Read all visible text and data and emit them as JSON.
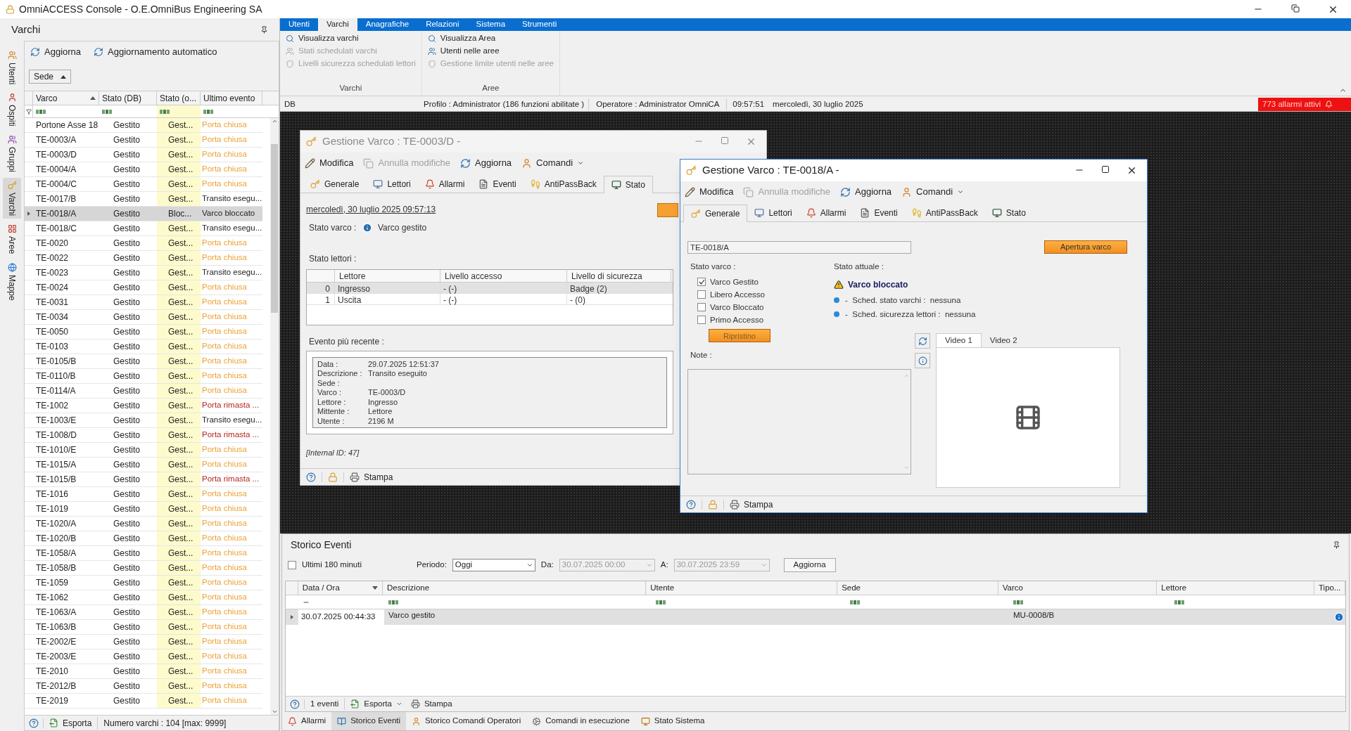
{
  "title_bar": {
    "title": "OmniACCESS Console - O.E.OmniBus Engineering SA"
  },
  "left_panel": {
    "title": "Varchi",
    "toolbar": [
      {
        "label": "Aggiorna"
      },
      {
        "label": "Aggiornamento automatico"
      }
    ],
    "side_tabs": [
      {
        "label": "Utenti",
        "selected": false
      },
      {
        "label": "Ospiti",
        "selected": false
      },
      {
        "label": "Gruppi",
        "selected": false
      },
      {
        "label": "Varchi",
        "selected": true
      },
      {
        "label": "Aree",
        "selected": false
      },
      {
        "label": "Mappe",
        "selected": false
      }
    ],
    "group_chip": "Sede",
    "columns": [
      "Varco",
      "Stato (DB)",
      "Stato (o...",
      "Ultimo evento"
    ],
    "rows": [
      {
        "varco": "Portone Asse 18",
        "stato_db": "Gestito",
        "stato_o": "Gest...",
        "ultimo_evento": "Porta chiusa",
        "color": "#eba134",
        "selected": false
      },
      {
        "varco": "TE-0003/A",
        "stato_db": "Gestito",
        "stato_o": "Gest...",
        "ultimo_evento": "Porta chiusa",
        "color": "#eba134",
        "selected": false
      },
      {
        "varco": "TE-0003/D",
        "stato_db": "Gestito",
        "stato_o": "Gest...",
        "ultimo_evento": "Porta chiusa",
        "color": "#eba134",
        "selected": false
      },
      {
        "varco": "TE-0004/A",
        "stato_db": "Gestito",
        "stato_o": "Gest...",
        "ultimo_evento": "Porta chiusa",
        "color": "#eba134",
        "selected": false
      },
      {
        "varco": "TE-0004/C",
        "stato_db": "Gestito",
        "stato_o": "Gest...",
        "ultimo_evento": "Porta chiusa",
        "color": "#eba134",
        "selected": false
      },
      {
        "varco": "TE-0017/B",
        "stato_db": "Gestito",
        "stato_o": "Gest...",
        "ultimo_evento": "Transito esegu...",
        "color": "#222222",
        "selected": false
      },
      {
        "varco": "TE-0018/A",
        "stato_db": "Gestito",
        "stato_o": "Bloc...",
        "ultimo_evento": "Varco bloccato",
        "color": "#222222",
        "selected": true
      },
      {
        "varco": "TE-0018/C",
        "stato_db": "Gestito",
        "stato_o": "Gest...",
        "ultimo_evento": "Transito esegu...",
        "color": "#222222",
        "selected": false
      },
      {
        "varco": "TE-0020",
        "stato_db": "Gestito",
        "stato_o": "Gest...",
        "ultimo_evento": "Porta chiusa",
        "color": "#eba134",
        "selected": false
      },
      {
        "varco": "TE-0022",
        "stato_db": "Gestito",
        "stato_o": "Gest...",
        "ultimo_evento": "Porta chiusa",
        "color": "#eba134",
        "selected": false
      },
      {
        "varco": "TE-0023",
        "stato_db": "Gestito",
        "stato_o": "Gest...",
        "ultimo_evento": "Transito esegu...",
        "color": "#222222",
        "selected": false
      },
      {
        "varco": "TE-0024",
        "stato_db": "Gestito",
        "stato_o": "Gest...",
        "ultimo_evento": "Porta chiusa",
        "color": "#eba134",
        "selected": false
      },
      {
        "varco": "TE-0031",
        "stato_db": "Gestito",
        "stato_o": "Gest...",
        "ultimo_evento": "Porta chiusa",
        "color": "#eba134",
        "selected": false
      },
      {
        "varco": "TE-0034",
        "stato_db": "Gestito",
        "stato_o": "Gest...",
        "ultimo_evento": "Porta chiusa",
        "color": "#eba134",
        "selected": false
      },
      {
        "varco": "TE-0050",
        "stato_db": "Gestito",
        "stato_o": "Gest...",
        "ultimo_evento": "Porta chiusa",
        "color": "#eba134",
        "selected": false
      },
      {
        "varco": "TE-0103",
        "stato_db": "Gestito",
        "stato_o": "Gest...",
        "ultimo_evento": "Porta chiusa",
        "color": "#eba134",
        "selected": false
      },
      {
        "varco": "TE-0105/B",
        "stato_db": "Gestito",
        "stato_o": "Gest...",
        "ultimo_evento": "Porta chiusa",
        "color": "#eba134",
        "selected": false
      },
      {
        "varco": "TE-0110/B",
        "stato_db": "Gestito",
        "stato_o": "Gest...",
        "ultimo_evento": "Porta chiusa",
        "color": "#eba134",
        "selected": false
      },
      {
        "varco": "TE-0114/A",
        "stato_db": "Gestito",
        "stato_o": "Gest...",
        "ultimo_evento": "Porta chiusa",
        "color": "#eba134",
        "selected": false
      },
      {
        "varco": "TE-1002",
        "stato_db": "Gestito",
        "stato_o": "Gest...",
        "ultimo_evento": "Porta rimasta ...",
        "color": "#b3261e",
        "selected": false
      },
      {
        "varco": "TE-1003/E",
        "stato_db": "Gestito",
        "stato_o": "Gest...",
        "ultimo_evento": "Transito esegu...",
        "color": "#222222",
        "selected": false
      },
      {
        "varco": "TE-1008/D",
        "stato_db": "Gestito",
        "stato_o": "Gest...",
        "ultimo_evento": "Porta rimasta ...",
        "color": "#b3261e",
        "selected": false
      },
      {
        "varco": "TE-1010/E",
        "stato_db": "Gestito",
        "stato_o": "Gest...",
        "ultimo_evento": "Porta chiusa",
        "color": "#eba134",
        "selected": false
      },
      {
        "varco": "TE-1015/A",
        "stato_db": "Gestito",
        "stato_o": "Gest...",
        "ultimo_evento": "Porta chiusa",
        "color": "#eba134",
        "selected": false
      },
      {
        "varco": "TE-1015/B",
        "stato_db": "Gestito",
        "stato_o": "Gest...",
        "ultimo_evento": "Porta rimasta ...",
        "color": "#b3261e",
        "selected": false
      },
      {
        "varco": "TE-1016",
        "stato_db": "Gestito",
        "stato_o": "Gest...",
        "ultimo_evento": "Porta chiusa",
        "color": "#eba134",
        "selected": false
      },
      {
        "varco": "TE-1019",
        "stato_db": "Gestito",
        "stato_o": "Gest...",
        "ultimo_evento": "Porta chiusa",
        "color": "#eba134",
        "selected": false
      },
      {
        "varco": "TE-1020/A",
        "stato_db": "Gestito",
        "stato_o": "Gest...",
        "ultimo_evento": "Porta chiusa",
        "color": "#eba134",
        "selected": false
      },
      {
        "varco": "TE-1020/B",
        "stato_db": "Gestito",
        "stato_o": "Gest...",
        "ultimo_evento": "Porta chiusa",
        "color": "#eba134",
        "selected": false
      },
      {
        "varco": "TE-1058/A",
        "stato_db": "Gestito",
        "stato_o": "Gest...",
        "ultimo_evento": "Porta chiusa",
        "color": "#eba134",
        "selected": false
      },
      {
        "varco": "TE-1058/B",
        "stato_db": "Gestito",
        "stato_o": "Gest...",
        "ultimo_evento": "Porta chiusa",
        "color": "#eba134",
        "selected": false
      },
      {
        "varco": "TE-1059",
        "stato_db": "Gestito",
        "stato_o": "Gest...",
        "ultimo_evento": "Porta chiusa",
        "color": "#eba134",
        "selected": false
      },
      {
        "varco": "TE-1062",
        "stato_db": "Gestito",
        "stato_o": "Gest...",
        "ultimo_evento": "Porta chiusa",
        "color": "#eba134",
        "selected": false
      },
      {
        "varco": "TE-1063/A",
        "stato_db": "Gestito",
        "stato_o": "Gest...",
        "ultimo_evento": "Porta chiusa",
        "color": "#eba134",
        "selected": false
      },
      {
        "varco": "TE-1063/B",
        "stato_db": "Gestito",
        "stato_o": "Gest...",
        "ultimo_evento": "Porta chiusa",
        "color": "#eba134",
        "selected": false
      },
      {
        "varco": "TE-2002/E",
        "stato_db": "Gestito",
        "stato_o": "Gest...",
        "ultimo_evento": "Porta chiusa",
        "color": "#eba134",
        "selected": false
      },
      {
        "varco": "TE-2003/E",
        "stato_db": "Gestito",
        "stato_o": "Gest...",
        "ultimo_evento": "Porta chiusa",
        "color": "#eba134",
        "selected": false
      },
      {
        "varco": "TE-2010",
        "stato_db": "Gestito",
        "stato_o": "Gest...",
        "ultimo_evento": "Porta chiusa",
        "color": "#eba134",
        "selected": false
      },
      {
        "varco": "TE-2012/B",
        "stato_db": "Gestito",
        "stato_o": "Gest...",
        "ultimo_evento": "Porta chiusa",
        "color": "#eba134",
        "selected": false
      },
      {
        "varco": "TE-2019",
        "stato_db": "Gestito",
        "stato_o": "Gest...",
        "ultimo_evento": "Porta chiusa",
        "color": "#eba134",
        "selected": false
      }
    ],
    "export": "Esporta",
    "count": "Numero varchi : 104 [max: 9999]"
  },
  "ribbon": {
    "tabs": [
      {
        "label": "Utenti",
        "selected": false
      },
      {
        "label": "Varchi",
        "selected": true
      },
      {
        "label": "Anagrafiche",
        "selected": false
      },
      {
        "label": "Relazioni",
        "selected": false
      },
      {
        "label": "Sistema",
        "selected": false
      },
      {
        "label": "Strumenti",
        "selected": false
      }
    ],
    "groups": [
      {
        "title": "Varchi",
        "items": [
          {
            "label": "Visualizza varchi",
            "disabled": false
          },
          {
            "label": "Stati schedulati varchi",
            "disabled": true
          },
          {
            "label": "Livelli sicurezza schedulati lettori",
            "disabled": true
          }
        ]
      },
      {
        "title": "Aree",
        "items": [
          {
            "label": "Visualizza Area",
            "disabled": false
          },
          {
            "label": "Utenti nelle aree",
            "disabled": false
          },
          {
            "label": "Gestione limite utenti nelle aree",
            "disabled": true
          }
        ]
      }
    ]
  },
  "status_line": {
    "db": "DB",
    "profile": "Profilo : Administrator (186  funzioni abilitate )",
    "operator": "Operatore : Administrator OmniCA",
    "time": "09:57:51",
    "date": "mercoledì, 30 luglio 2025",
    "alarms": "773 allarmi attivi"
  },
  "status_window": {
    "title": "Gestione Varco : TE-0003/D -",
    "active": false,
    "toolbar": [
      {
        "label": "Modifica",
        "disabled": false,
        "dropdown": false
      },
      {
        "label": "Annulla modifiche",
        "disabled": true,
        "dropdown": false
      },
      {
        "label": "Aggiorna",
        "disabled": false,
        "dropdown": false
      },
      {
        "label": "Comandi",
        "disabled": false,
        "dropdown": true
      }
    ],
    "tabs": [
      {
        "label": "Generale",
        "selected": false
      },
      {
        "label": "Lettori",
        "selected": false
      },
      {
        "label": "Allarmi",
        "selected": false
      },
      {
        "label": "Eventi",
        "selected": false
      },
      {
        "label": "AntiPassBack",
        "selected": false
      },
      {
        "label": "Stato",
        "selected": true
      }
    ],
    "timestamp": "mercoledì, 30 luglio 2025 09:57:13",
    "gate_state_label": "Stato varco :",
    "gate_state": "Varco gestito",
    "readers_label": "Stato lettori :",
    "reader_columns": [
      "Lettore",
      "Livello accesso",
      "Livello di sicurezza"
    ],
    "readers": [
      {
        "index": "0",
        "name": "Ingresso",
        "access": "- (-)",
        "security": "Badge (2)",
        "selected": true
      },
      {
        "index": "1",
        "name": "Uscita",
        "access": "- (-)",
        "security": "- (0)",
        "selected": false
      }
    ],
    "event_label": "Evento più recente :",
    "event_fields": [
      {
        "label": "Data :",
        "value": "29.07.2025 12:51:37"
      },
      {
        "label": "Descrizione :",
        "value": "Transito eseguito"
      },
      {
        "label": "Sede :"
      },
      {
        "label": "Varco :",
        "value": "TE-0003/D"
      },
      {
        "label": "Lettore :",
        "value": "Ingresso"
      },
      {
        "label": "Mittente :",
        "value": "Lettore"
      },
      {
        "label": "Utente :",
        "value": "2196 M"
      }
    ],
    "internal_id": "[Internal ID: 47]",
    "print": "Stampa"
  },
  "general_window": {
    "title": "Gestione Varco : TE-0018/A -",
    "active": true,
    "toolbar": [
      {
        "label": "Modifica",
        "disabled": false,
        "dropdown": false
      },
      {
        "label": "Annulla modifiche",
        "disabled": true,
        "dropdown": false
      },
      {
        "label": "Aggiorna",
        "disabled": false,
        "dropdown": false
      },
      {
        "label": "Comandi",
        "disabled": false,
        "dropdown": true
      }
    ],
    "tabs": [
      {
        "label": "Generale",
        "selected": true
      },
      {
        "label": "Lettori",
        "selected": false
      },
      {
        "label": "Allarmi",
        "selected": false
      },
      {
        "label": "Eventi",
        "selected": false
      },
      {
        "label": "AntiPassBack",
        "selected": false
      },
      {
        "label": "Stato",
        "selected": false
      }
    ],
    "gate_code": "TE-0018/A",
    "open_button": "Apertura varco",
    "gate_state_label": "Stato varco :",
    "checks": [
      {
        "label": "Varco Gestito",
        "checked": true
      },
      {
        "label": "Libero Accesso",
        "checked": false
      },
      {
        "label": "Varco Bloccato",
        "checked": false
      },
      {
        "label": "Primo Accesso",
        "checked": false
      }
    ],
    "reset_button": "Ripristino",
    "note_label": "Note :",
    "current_label": "Stato attuale :",
    "current_state": "Varco bloccato",
    "schedules": [
      "-  Sched. stato varchi :  nessuna",
      "-  Sched. sicurezza lettori :  nessuna"
    ],
    "video_tabs": [
      {
        "label": "Video 1",
        "selected": true
      },
      {
        "label": "Video 2",
        "selected": false
      }
    ],
    "print": "Stampa"
  },
  "event_history": {
    "title": "Storico Eventi",
    "last_minutes": {
      "label": "Ultimi 180 minuti",
      "checked": false
    },
    "period_label": "Periodo:",
    "period": "Oggi",
    "from_label": "Da:",
    "from": "30.07.2025 00:00",
    "to_label": "A:",
    "to": "30.07.2025 23:59",
    "refresh": "Aggiorna",
    "columns": [
      "Data / Ora",
      "Descrizione",
      "Utente",
      "Sede",
      "Varco",
      "Lettore",
      "Tipo..."
    ],
    "rows": [
      {
        "datetime": "30.07.2025 00:44:33",
        "description": "Varco gestito",
        "gate": "MU-0008/B"
      }
    ],
    "count": "1 eventi",
    "export": "Esporta",
    "print": "Stampa"
  },
  "bottom_tabs": [
    {
      "label": "Allarmi",
      "selected": false
    },
    {
      "label": "Storico Eventi",
      "selected": true
    },
    {
      "label": "Storico Comandi Operatori",
      "selected": false
    },
    {
      "label": "Comandi in esecuzione",
      "selected": false
    },
    {
      "label": "Stato Sistema",
      "selected": false
    }
  ]
}
